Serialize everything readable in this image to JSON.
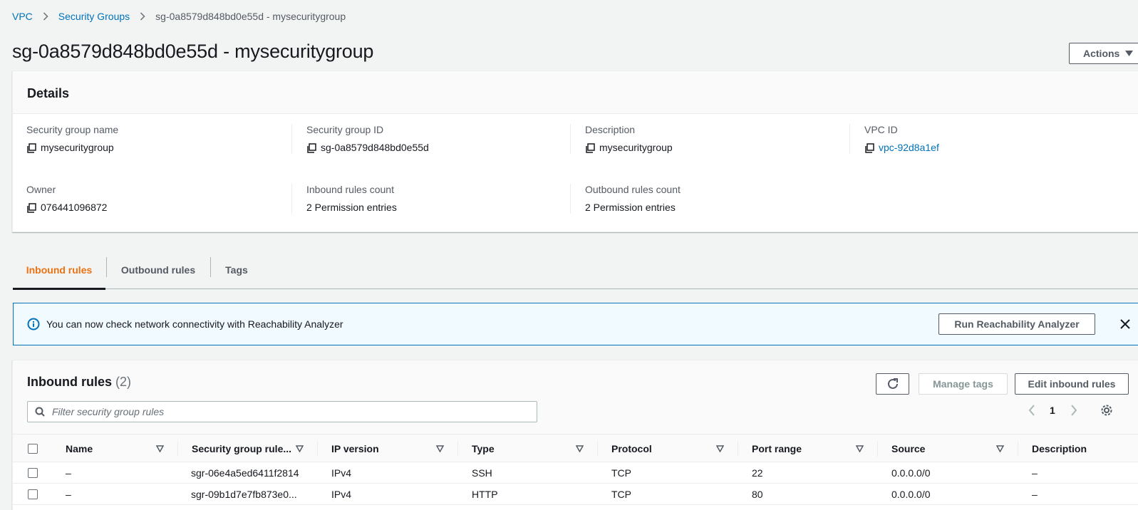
{
  "breadcrumb": {
    "items": [
      "VPC",
      "Security Groups"
    ],
    "current": "sg-0a8579d848bd0e55d - mysecuritygroup"
  },
  "page": {
    "title": "sg-0a8579d848bd0e55d - mysecuritygroup",
    "actions_label": "Actions"
  },
  "details": {
    "heading": "Details",
    "fields": [
      {
        "label": "Security group name",
        "value": "mysecuritygroup"
      },
      {
        "label": "Security group ID",
        "value": "sg-0a8579d848bd0e55d"
      },
      {
        "label": "Description",
        "value": "mysecuritygroup"
      },
      {
        "label": "VPC ID",
        "value": "vpc-92d8a1ef"
      },
      {
        "label": "Owner",
        "value": "076441096872"
      },
      {
        "label": "Inbound rules count",
        "value": "2 Permission entries"
      },
      {
        "label": "Outbound rules count",
        "value": "2 Permission entries"
      }
    ]
  },
  "tabs": [
    "Inbound rules",
    "Outbound rules",
    "Tags"
  ],
  "flash": {
    "message": "You can now check network connectivity with Reachability Analyzer",
    "button_label": "Run Reachability Analyzer"
  },
  "rules": {
    "title": "Inbound rules",
    "count": "(2)",
    "manage_tags_label": "Manage tags",
    "edit_label": "Edit inbound rules",
    "filter_placeholder": "Filter security group rules",
    "page": "1",
    "columns": [
      "Name",
      "Security group rule...",
      "IP version",
      "Type",
      "Protocol",
      "Port range",
      "Source",
      "Description"
    ],
    "rows": [
      [
        "–",
        "sgr-06e4a5ed6411f2814",
        "IPv4",
        "SSH",
        "TCP",
        "22",
        "0.0.0.0/0",
        "–"
      ],
      [
        "–",
        "sgr-09b1d7e7fb873e0...",
        "IPv4",
        "HTTP",
        "TCP",
        "80",
        "0.0.0.0/0",
        "–"
      ]
    ]
  },
  "colors": {
    "link": "#0073bb",
    "active_tab": "#ec7211",
    "info_bg": "#f1faff",
    "text": "#16191f"
  }
}
